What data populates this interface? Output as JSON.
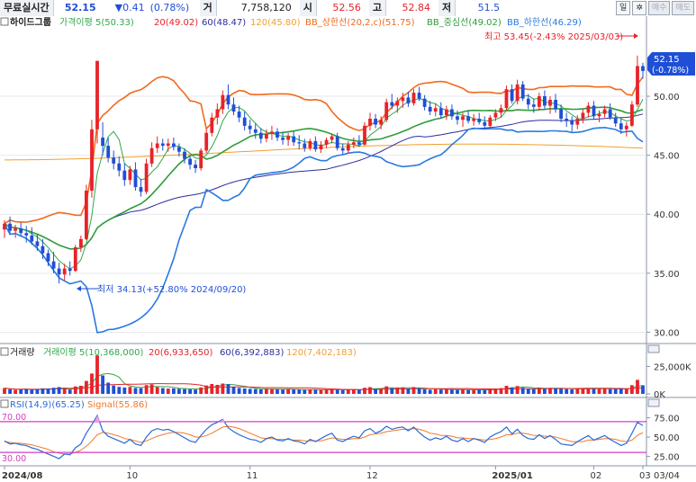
{
  "header": {
    "name_label": "무료실시간",
    "price": "52.15",
    "change": "▼0.41",
    "change_pct": "(0.78%)",
    "volume_label": "거",
    "volume": "7,758,120",
    "open_label": "시",
    "open": "52.56",
    "high_label": "고",
    "high": "52.84",
    "low_label": "저",
    "low": "51.5",
    "period_button": "일",
    "buy_label": "매수",
    "sell_label": "매도"
  },
  "colors": {
    "up": "#e8222a",
    "down": "#1f4fd6",
    "ma5": "#2fa84a",
    "ma20": "#2f9c3a",
    "ma60": "#2d2da0",
    "ma120": "#f0a030",
    "bb_upper": "#f06a1c",
    "bb_lower": "#2a7ae0",
    "rsi": "#2a6ad8",
    "signal": "#f07828"
  },
  "chart_data": [
    {
      "type": "candlestick",
      "title": "하이드그룹",
      "legend": [
        {
          "label": "가격이평 5(50.33)",
          "color": "#2fa84a"
        },
        {
          "label": "20(49.02)",
          "color": "#e8222a"
        },
        {
          "label": "60(48.47)",
          "color": "#2d2da0"
        },
        {
          "label": "120(45.80)",
          "color": "#f0a030"
        },
        {
          "label": "BB_상한선(20,2,c)(51.75)",
          "color": "#f06a1c"
        },
        {
          "label": "BB_중심선(49.02)",
          "color": "#2f9c3a"
        },
        {
          "label": "BB_하한선(46.29)",
          "color": "#2a7ae0"
        }
      ],
      "y_ticks": [
        "30.00",
        "35.00",
        "40.00",
        "45.00",
        "50.00"
      ],
      "ylim": [
        29.5,
        54.5
      ],
      "x_ticks": [
        "2024/08",
        "10",
        "11",
        "12",
        "2025/01",
        "02",
        "03"
      ],
      "high_annotation": "최고 53.45(-2.43% 2025/03/03)",
      "low_annotation": "최저 34.13(+52.80% 2024/09/20)",
      "current_price_label": "52.15",
      "current_pct_label": "(-0.78%)",
      "ohlc": [
        [
          38.7,
          39.5,
          38.0,
          39.2
        ],
        [
          39.2,
          39.8,
          38.3,
          38.6
        ],
        [
          38.6,
          39.1,
          38.0,
          38.8
        ],
        [
          38.8,
          39.3,
          38.1,
          38.4
        ],
        [
          38.4,
          39.0,
          37.6,
          38.2
        ],
        [
          38.2,
          38.9,
          37.4,
          37.7
        ],
        [
          37.7,
          38.3,
          36.9,
          37.3
        ],
        [
          37.3,
          37.9,
          36.2,
          36.7
        ],
        [
          36.7,
          37.0,
          35.6,
          36.0
        ],
        [
          36.0,
          36.8,
          35.0,
          35.4
        ],
        [
          35.4,
          35.9,
          34.13,
          34.9
        ],
        [
          34.9,
          35.8,
          34.4,
          35.4
        ],
        [
          35.4,
          36.0,
          34.8,
          35.2
        ],
        [
          35.2,
          37.4,
          35.1,
          37.2
        ],
        [
          37.2,
          38.2,
          36.8,
          37.9
        ],
        [
          37.9,
          42.5,
          37.8,
          42.0
        ],
        [
          42.0,
          48.0,
          41.4,
          47.2
        ],
        [
          47.2,
          53.0,
          46.0,
          53.0
        ],
        [
          46.5,
          47.8,
          45.0,
          45.8
        ],
        [
          45.8,
          46.5,
          44.4,
          44.8
        ],
        [
          44.8,
          45.4,
          43.8,
          44.3
        ],
        [
          44.3,
          44.9,
          43.2,
          43.7
        ],
        [
          43.7,
          44.3,
          42.4,
          42.9
        ],
        [
          42.9,
          44.1,
          42.5,
          43.8
        ],
        [
          43.8,
          44.4,
          42.0,
          42.3
        ],
        [
          42.3,
          43.0,
          41.5,
          41.9
        ],
        [
          41.9,
          44.7,
          41.7,
          44.3
        ],
        [
          44.3,
          46.1,
          44.0,
          45.6
        ],
        [
          45.6,
          46.6,
          45.2,
          46.0
        ],
        [
          46.0,
          46.4,
          45.4,
          45.8
        ],
        [
          45.8,
          46.4,
          45.3,
          46.0
        ],
        [
          46.0,
          46.5,
          45.4,
          45.7
        ],
        [
          45.7,
          46.0,
          44.9,
          45.3
        ],
        [
          45.3,
          45.6,
          44.3,
          44.7
        ],
        [
          44.7,
          45.0,
          43.8,
          44.2
        ],
        [
          44.2,
          44.6,
          43.5,
          43.9
        ],
        [
          43.9,
          45.6,
          43.7,
          45.4
        ],
        [
          45.4,
          47.2,
          45.2,
          46.9
        ],
        [
          46.9,
          48.6,
          46.6,
          48.2
        ],
        [
          48.2,
          49.4,
          47.6,
          48.9
        ],
        [
          48.9,
          50.5,
          48.5,
          50.1
        ],
        [
          50.1,
          51.0,
          48.9,
          49.3
        ],
        [
          49.3,
          49.9,
          48.4,
          48.7
        ],
        [
          48.7,
          49.2,
          47.8,
          48.2
        ],
        [
          48.2,
          48.7,
          47.1,
          47.5
        ],
        [
          47.5,
          48.0,
          46.8,
          47.2
        ],
        [
          47.2,
          47.7,
          46.4,
          46.9
        ],
        [
          46.9,
          47.3,
          46.0,
          46.4
        ],
        [
          46.4,
          47.2,
          46.1,
          46.8
        ],
        [
          46.8,
          47.5,
          46.3,
          47.0
        ],
        [
          47.0,
          47.3,
          46.2,
          46.5
        ],
        [
          46.5,
          47.0,
          45.9,
          46.3
        ],
        [
          46.3,
          46.9,
          45.8,
          46.6
        ],
        [
          46.6,
          47.0,
          45.8,
          46.1
        ],
        [
          46.1,
          46.7,
          45.5,
          46.0
        ],
        [
          46.0,
          46.4,
          45.3,
          45.6
        ],
        [
          45.6,
          46.4,
          45.4,
          46.2
        ],
        [
          46.2,
          46.6,
          45.3,
          45.5
        ],
        [
          45.5,
          46.2,
          45.2,
          45.9
        ],
        [
          45.9,
          46.5,
          45.6,
          46.3
        ],
        [
          46.3,
          46.8,
          46.0,
          46.6
        ],
        [
          46.6,
          46.9,
          45.4,
          45.6
        ],
        [
          45.6,
          46.0,
          45.1,
          45.4
        ],
        [
          45.4,
          46.2,
          45.2,
          45.9
        ],
        [
          45.9,
          46.5,
          45.6,
          46.1
        ],
        [
          46.1,
          46.7,
          45.7,
          45.9
        ],
        [
          45.9,
          47.8,
          45.8,
          47.5
        ],
        [
          47.5,
          48.6,
          47.1,
          48.1
        ],
        [
          48.1,
          48.5,
          47.3,
          47.6
        ],
        [
          47.6,
          48.3,
          47.2,
          48.0
        ],
        [
          48.0,
          49.8,
          47.8,
          49.5
        ],
        [
          49.5,
          50.2,
          48.9,
          49.2
        ],
        [
          49.2,
          49.9,
          48.6,
          49.6
        ],
        [
          49.6,
          50.3,
          49.0,
          49.9
        ],
        [
          49.9,
          50.4,
          49.1,
          49.4
        ],
        [
          49.4,
          50.6,
          49.2,
          50.3
        ],
        [
          50.3,
          50.8,
          49.6,
          49.8
        ],
        [
          49.8,
          50.1,
          48.8,
          49.1
        ],
        [
          49.1,
          49.6,
          48.4,
          48.7
        ],
        [
          48.7,
          49.4,
          48.3,
          49.0
        ],
        [
          49.0,
          49.5,
          48.1,
          48.4
        ],
        [
          48.4,
          49.2,
          48.0,
          48.9
        ],
        [
          48.9,
          49.3,
          48.0,
          48.3
        ],
        [
          48.3,
          48.8,
          47.6,
          48.0
        ],
        [
          48.0,
          48.6,
          47.4,
          48.3
        ],
        [
          48.3,
          48.8,
          47.7,
          47.9
        ],
        [
          47.9,
          48.5,
          47.5,
          48.1
        ],
        [
          48.1,
          48.6,
          47.6,
          47.8
        ],
        [
          47.8,
          48.3,
          47.2,
          47.5
        ],
        [
          47.5,
          48.4,
          47.3,
          48.2
        ],
        [
          48.2,
          48.9,
          47.9,
          48.6
        ],
        [
          48.6,
          49.3,
          48.2,
          49.0
        ],
        [
          49.0,
          50.9,
          48.8,
          50.6
        ],
        [
          50.6,
          51.0,
          49.4,
          49.6
        ],
        [
          49.6,
          51.4,
          49.3,
          51.0
        ],
        [
          51.0,
          51.3,
          49.6,
          49.8
        ],
        [
          49.8,
          50.2,
          48.9,
          49.3
        ],
        [
          49.3,
          49.8,
          48.6,
          49.1
        ],
        [
          49.1,
          50.3,
          48.8,
          50.0
        ],
        [
          50.0,
          50.5,
          48.9,
          49.2
        ],
        [
          49.2,
          50.0,
          48.5,
          49.7
        ],
        [
          49.7,
          50.2,
          48.6,
          48.9
        ],
        [
          48.9,
          49.3,
          47.8,
          48.1
        ],
        [
          48.1,
          48.6,
          47.4,
          47.9
        ],
        [
          47.9,
          48.3,
          47.0,
          47.6
        ],
        [
          47.6,
          48.4,
          47.2,
          48.1
        ],
        [
          48.1,
          48.9,
          47.7,
          48.6
        ],
        [
          48.6,
          49.5,
          48.2,
          49.2
        ],
        [
          49.2,
          49.6,
          48.0,
          48.3
        ],
        [
          48.3,
          48.8,
          47.8,
          48.5
        ],
        [
          48.5,
          49.2,
          48.2,
          48.9
        ],
        [
          48.9,
          49.4,
          48.0,
          48.2
        ],
        [
          48.2,
          48.6,
          47.4,
          47.7
        ],
        [
          47.7,
          48.1,
          46.8,
          47.2
        ],
        [
          47.2,
          47.8,
          46.6,
          47.5
        ],
        [
          47.5,
          49.6,
          47.4,
          49.3
        ],
        [
          49.3,
          53.45,
          49.1,
          52.56
        ],
        [
          52.56,
          52.84,
          51.5,
          52.15
        ]
      ]
    },
    {
      "type": "bar",
      "title": "거래량",
      "legend": [
        {
          "label": "거래이평 5(10,368,000)",
          "color": "#2fa84a"
        },
        {
          "label": "20(6,933,650)",
          "color": "#e8222a"
        },
        {
          "label": "60(6,392,883)",
          "color": "#2d2da0"
        },
        {
          "label": "120(7,402,183)",
          "color": "#f0a030"
        }
      ],
      "y_ticks": [
        "0K",
        "25,000K"
      ],
      "ylim": [
        0,
        36000
      ],
      "values": [
        5200,
        4100,
        3600,
        3900,
        4300,
        3700,
        4500,
        5000,
        4800,
        5600,
        6200,
        5100,
        3900,
        6800,
        7400,
        11800,
        18500,
        35000,
        16800,
        10200,
        7600,
        6400,
        5800,
        6300,
        5400,
        5200,
        7900,
        8600,
        6100,
        5300,
        4800,
        5000,
        4600,
        4300,
        4100,
        3900,
        5800,
        7600,
        9000,
        8200,
        9400,
        8800,
        6200,
        5300,
        4900,
        4600,
        4400,
        4100,
        4500,
        4300,
        4200,
        3900,
        4300,
        4000,
        3800,
        3600,
        4100,
        3700,
        3500,
        3900,
        4200,
        3800,
        3400,
        3700,
        3900,
        3600,
        5600,
        6100,
        4400,
        4800,
        6900,
        5200,
        5600,
        5800,
        4900,
        6200,
        5100,
        4200,
        3800,
        4100,
        3900,
        4500,
        3700,
        3600,
        4000,
        3500,
        3800,
        3600,
        3400,
        4200,
        4800,
        5200,
        7400,
        5900,
        7100,
        5600,
        4800,
        4400,
        5300,
        4900,
        5500,
        5100,
        4600,
        4300,
        4100,
        4500,
        4800,
        5300,
        4700,
        4400,
        4600,
        4300,
        4500,
        4800,
        4600,
        7900,
        12800,
        7758
      ]
    },
    {
      "type": "line",
      "title": "RSI",
      "legend": [
        {
          "label": "RSI(14,9)(65.25)",
          "color": "#2a6ad8"
        },
        {
          "label": "Signal(55.86)",
          "color": "#f07828"
        }
      ],
      "y_ticks": [
        "25.00",
        "50.00",
        "75.00"
      ],
      "ylim": [
        15,
        85
      ],
      "ref_lines": [
        70,
        30
      ],
      "ref_labels": [
        "70.00",
        "30.00"
      ],
      "rsi": [
        45,
        41,
        42,
        40,
        39,
        36,
        34,
        31,
        28,
        25,
        22,
        28,
        27,
        36,
        41,
        55,
        66,
        78,
        58,
        51,
        48,
        45,
        42,
        47,
        41,
        39,
        50,
        58,
        61,
        59,
        60,
        57,
        53,
        49,
        45,
        43,
        52,
        60,
        66,
        69,
        73,
        62,
        57,
        53,
        50,
        47,
        46,
        43,
        48,
        50,
        46,
        45,
        48,
        45,
        44,
        41,
        47,
        44,
        48,
        52,
        55,
        46,
        44,
        48,
        51,
        49,
        58,
        61,
        55,
        58,
        64,
        60,
        62,
        63,
        58,
        63,
        56,
        50,
        46,
        49,
        47,
        51,
        46,
        44,
        48,
        44,
        48,
        46,
        43,
        50,
        54,
        57,
        63,
        54,
        60,
        52,
        48,
        47,
        53,
        48,
        52,
        47,
        41,
        40,
        39,
        44,
        48,
        52,
        46,
        49,
        52,
        47,
        43,
        39,
        42,
        55,
        69,
        65
      ],
      "signal": [
        44,
        43,
        42,
        42,
        41,
        40,
        38,
        36,
        34,
        31,
        29,
        28,
        28,
        30,
        33,
        38,
        45,
        53,
        56,
        55,
        53,
        51,
        48,
        47,
        45,
        43,
        45,
        48,
        51,
        53,
        55,
        56,
        56,
        55,
        53,
        50,
        50,
        52,
        55,
        59,
        63,
        64,
        63,
        61,
        58,
        55,
        52,
        49,
        48,
        48,
        47,
        47,
        47,
        46,
        46,
        45,
        45,
        45,
        45,
        47,
        49,
        48,
        47,
        47,
        48,
        48,
        50,
        53,
        54,
        55,
        57,
        58,
        59,
        60,
        60,
        61,
        60,
        58,
        55,
        54,
        52,
        52,
        51,
        49,
        49,
        48,
        48,
        47,
        46,
        47,
        48,
        50,
        53,
        53,
        55,
        55,
        54,
        52,
        52,
        51,
        51,
        50,
        48,
        46,
        44,
        44,
        44,
        46,
        46,
        47,
        48,
        48,
        47,
        45,
        44,
        46,
        52,
        56
      ]
    }
  ],
  "date_label": "03/04"
}
